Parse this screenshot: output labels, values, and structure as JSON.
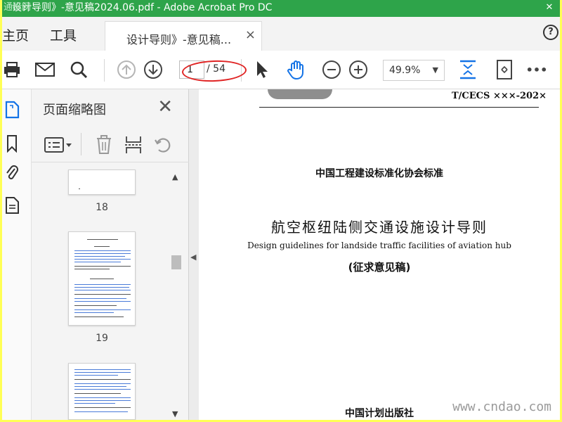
{
  "window": {
    "title": "设计导则》-意见稿2024.06.pdf - Adobe Acrobat Pro DC",
    "watermark_top": "通标网"
  },
  "tabs": {
    "home": "主页",
    "tools": "工具",
    "document_tab": "设计导则》-意见稿...",
    "close": "×"
  },
  "toolbar": {
    "current_page": "1",
    "total_pages": "/ 54",
    "zoom": "49.9%",
    "more": "•••"
  },
  "thumbnails": {
    "title": "页面缩略图",
    "pages": [
      "18",
      "19"
    ]
  },
  "document": {
    "standard_code": "T/CECS ×××-202×",
    "association": "中国工程建设标准化协会标准",
    "title_cn": "航空枢纽陆侧交通设施设计导则",
    "title_en": "Design guidelines for landside traffic facilities of aviation hub",
    "draft_label": "(征求意见稿)",
    "publisher": "中国计划出版社"
  },
  "site_watermark": "www.cndao.com",
  "colors": {
    "titlebar": "#2ea44a",
    "accent_blue": "#1473e6",
    "annotation_red": "#e02424",
    "frame_yellow": "#ffff55"
  }
}
